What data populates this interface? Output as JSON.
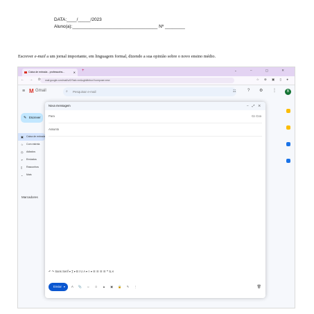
{
  "header": {
    "date_line": "DATA:____/_____/2023",
    "student_line": "Aluno(a):__________________________________ Nº ________"
  },
  "prompt": {
    "before": "Escrever ",
    "italic": "e-mail",
    "after": " a um jornal importante, em linguagem formal, dizendo a sua opinião sobre o novo ensino médio."
  },
  "browser": {
    "tab_title": "Caixa de entrada - professorbs...",
    "url": "mail.google.com/mail/u/0/?tab=rm&ogbl#inbox?compose=new",
    "window_controls": "⌄ – ▢ ✕"
  },
  "gmail": {
    "logo_letter": "M",
    "logo_word": "Gmail",
    "search_placeholder": "Pesquisar e-mail",
    "compose_button": "Escrever",
    "nav_items": [
      {
        "label": "Caixa de entrada",
        "icon": "inbox-icon",
        "glyph": "▣"
      },
      {
        "label": "Com estrela",
        "icon": "star-icon",
        "glyph": "☆"
      },
      {
        "label": "Adiados",
        "icon": "clock-icon",
        "glyph": "◷"
      },
      {
        "label": "Enviados",
        "icon": "send-icon",
        "glyph": "➢"
      },
      {
        "label": "Rascunhos",
        "icon": "draft-icon",
        "glyph": "▯"
      },
      {
        "label": "Mais",
        "icon": "chevron-down-icon",
        "glyph": "⌄"
      }
    ],
    "labels_heading": "Marcadores",
    "avatar_letter": "B"
  },
  "compose": {
    "title": "Nova mensagem",
    "window_controls": "– ⤢ ✕",
    "to_placeholder": "Para",
    "cc_label": "Cc Cco",
    "subject_placeholder": "Assunto",
    "format_bar": "↶  ↷  Sans Serif ▾  T̲ ▾  B  I  U  A ▾  ≡ ▾  ☰  ☰  ☰  ☰  ❞  S̶  ✕",
    "send_label": "Enviar",
    "send_arrow": "▾",
    "send_icons": "A  📎  ⇔  ☺  ▲  ▣  🔒  ✎  ⋮",
    "trash_icon": "🗑"
  },
  "colors": {
    "tab_bar": "#e3d3f2",
    "gmail_red": "#d93025",
    "compose_button_bg": "#c2e7ff",
    "send_button_bg": "#0b57d0"
  }
}
